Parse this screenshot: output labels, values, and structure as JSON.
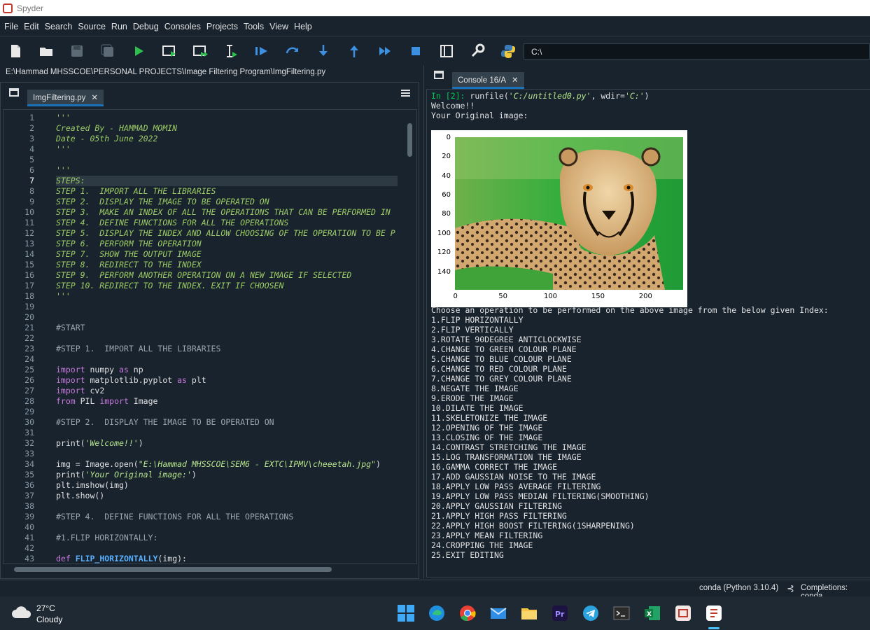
{
  "window": {
    "title": "Spyder"
  },
  "menu": [
    "File",
    "Edit",
    "Search",
    "Source",
    "Run",
    "Debug",
    "Consoles",
    "Projects",
    "Tools",
    "View",
    "Help"
  ],
  "toolbar": {
    "working_dir": "C:\\"
  },
  "editor": {
    "file_path": "E:\\Hammad MHSSCOE\\PERSONAL PROJECTS\\Image Filtering Program\\ImgFiltering.py",
    "tab_label": "ImgFiltering.py",
    "current_line": 7,
    "lines": [
      [
        [
          "doc",
          "'''"
        ]
      ],
      [
        [
          "doc",
          "Created By - HAMMAD MOMIN"
        ]
      ],
      [
        [
          "doc",
          "Date - 05th June 2022"
        ]
      ],
      [
        [
          "doc",
          "'''"
        ]
      ],
      [],
      [
        [
          "doc",
          "'''"
        ]
      ],
      [
        [
          "doc",
          "STEPS:"
        ]
      ],
      [
        [
          "doc",
          "STEP 1.  IMPORT ALL THE LIBRARIES"
        ]
      ],
      [
        [
          "doc",
          "STEP 2.  DISPLAY THE IMAGE TO BE OPERATED ON"
        ]
      ],
      [
        [
          "doc",
          "STEP 3.  MAKE AN INDEX OF ALL THE OPERATIONS THAT CAN BE PERFORMED IN"
        ]
      ],
      [
        [
          "doc",
          "STEP 4.  DEFINE FUNCTIONS FOR ALL THE OPERATIONS"
        ]
      ],
      [
        [
          "doc",
          "STEP 5.  DISPLAY THE INDEX AND ALLOW CHOOSING OF THE OPERATION TO BE P"
        ]
      ],
      [
        [
          "doc",
          "STEP 6.  PERFORM THE OPERATION"
        ]
      ],
      [
        [
          "doc",
          "STEP 7.  SHOW THE OUTPUT IMAGE"
        ]
      ],
      [
        [
          "doc",
          "STEP 8.  REDIRECT TO THE INDEX"
        ]
      ],
      [
        [
          "doc",
          "STEP 9.  PERFORM ANOTHER OPERATION ON A NEW IMAGE IF SELECTED"
        ]
      ],
      [
        [
          "doc",
          "STEP 10. REDIRECT TO THE INDEX. EXIT IF CHOOSEN"
        ]
      ],
      [
        [
          "doc",
          "'''"
        ]
      ],
      [],
      [],
      [
        [
          "cmt",
          "#START"
        ]
      ],
      [],
      [
        [
          "cmt",
          "#STEP 1.  IMPORT ALL THE LIBRARIES"
        ]
      ],
      [],
      [
        [
          "kw",
          "import"
        ],
        [
          "pl",
          " numpy "
        ],
        [
          "kw",
          "as"
        ],
        [
          "pl",
          " np"
        ]
      ],
      [
        [
          "kw",
          "import"
        ],
        [
          "pl",
          " matplotlib.pyplot "
        ],
        [
          "kw",
          "as"
        ],
        [
          "pl",
          " plt"
        ]
      ],
      [
        [
          "kw",
          "import"
        ],
        [
          "pl",
          " cv2"
        ]
      ],
      [
        [
          "kw",
          "from"
        ],
        [
          "pl",
          " PIL "
        ],
        [
          "kw",
          "import"
        ],
        [
          "pl",
          " Image"
        ]
      ],
      [],
      [
        [
          "cmt",
          "#STEP 2.  DISPLAY THE IMAGE TO BE OPERATED ON"
        ]
      ],
      [],
      [
        [
          "pl",
          "print("
        ],
        [
          "str",
          "'Welcome!!'"
        ],
        [
          "pl",
          ")"
        ]
      ],
      [],
      [
        [
          "pl",
          "img = Image.open("
        ],
        [
          "str",
          "\"E:\\Hammad MHSSCOE\\SEM6 - EXTC\\IPMV\\cheeetah.jpg\""
        ],
        [
          "pl",
          ")"
        ]
      ],
      [
        [
          "pl",
          "print("
        ],
        [
          "str",
          "'Your Original image:'"
        ],
        [
          "pl",
          ")"
        ]
      ],
      [
        [
          "pl",
          "plt.imshow(img)"
        ]
      ],
      [
        [
          "pl",
          "plt.show()"
        ]
      ],
      [],
      [
        [
          "cmt",
          "#STEP 4.  DEFINE FUNCTIONS FOR ALL THE OPERATIONS"
        ]
      ],
      [],
      [
        [
          "cmt",
          "#1.FLIP HORIZONTALLY:"
        ]
      ],
      [],
      [
        [
          "kw",
          "def"
        ],
        [
          "pl",
          " "
        ],
        [
          "fn",
          "FLIP_HORIZONTALLY"
        ],
        [
          "pl",
          "(img):"
        ]
      ]
    ]
  },
  "console": {
    "tab_label": "Console 16/A",
    "prompt": "In [2]:",
    "run_cmd": " runfile(",
    "run_arg1": "'C:/untitled0.py'",
    "run_mid": ", wdir=",
    "run_arg2": "'C:'",
    "run_end": ")",
    "welcome": "Welcome!!",
    "orig_label": "Your Original image:",
    "plot": {
      "y_ticks": [
        "0",
        "20",
        "40",
        "60",
        "80",
        "100",
        "120",
        "140"
      ],
      "x_ticks": [
        "0",
        "50",
        "100",
        "150",
        "200"
      ]
    },
    "index_header": "Choose an operation to be performed on the above image from the below given Index:",
    "options": [
      "1.FLIP HORIZONTALLY",
      "2.FLIP VERTICALLY",
      "3.ROTATE 90DEGREE ANTICLOCKWISE",
      "4.CHANGE TO GREEN COLOUR PLANE",
      "5.CHANGE TO BLUE COLOUR PLANE",
      "6.CHANGE TO RED COLOUR PLANE",
      "7.CHANGE TO GREY COLOUR PLANE",
      "8.NEGATE THE IMAGE",
      "9.ERODE THE IMAGE",
      "10.DILATE THE IMAGE",
      "11.SKELETONIZE THE IMAGE",
      "12.OPENING OF THE IMAGE",
      "13.CLOSING OF THE IMAGE",
      "14.CONTRAST STRETCHING THE IMAGE",
      "15.LOG TRANSFORMATION THE IMAGE",
      "16.GAMMA CORRECT THE IMAGE",
      "17.ADD GAUSSIAN NOISE TO THE IMAGE",
      "18.APPLY LOW PASS AVERAGE FILTERING",
      "19.APPLY LOW PASS MEDIAN FILTERING(SMOOTHING)",
      "20.APPLY GAUSSIAN FILTERING",
      "21.APPLY HIGH PASS FILTERING",
      "22.APPLY HIGH BOOST FILTERING(1SHARPENING)",
      "23.APPLY MEAN FILTERING",
      "24.CROPPING THE IMAGE",
      "25.EXIT EDITING"
    ]
  },
  "status": {
    "interpreter": "conda (Python 3.10.4)",
    "completions": "Completions: conda"
  },
  "weather": {
    "temp": "27°C",
    "condition": "Cloudy"
  },
  "taskbar_icons": [
    "windows-start-icon",
    "edge-icon",
    "chrome-icon",
    "mail-icon",
    "file-explorer-icon",
    "premiere-pro-icon",
    "telegram-icon",
    "terminal-icon",
    "excel-icon",
    "spyder-icon",
    "spyder-active-icon"
  ]
}
